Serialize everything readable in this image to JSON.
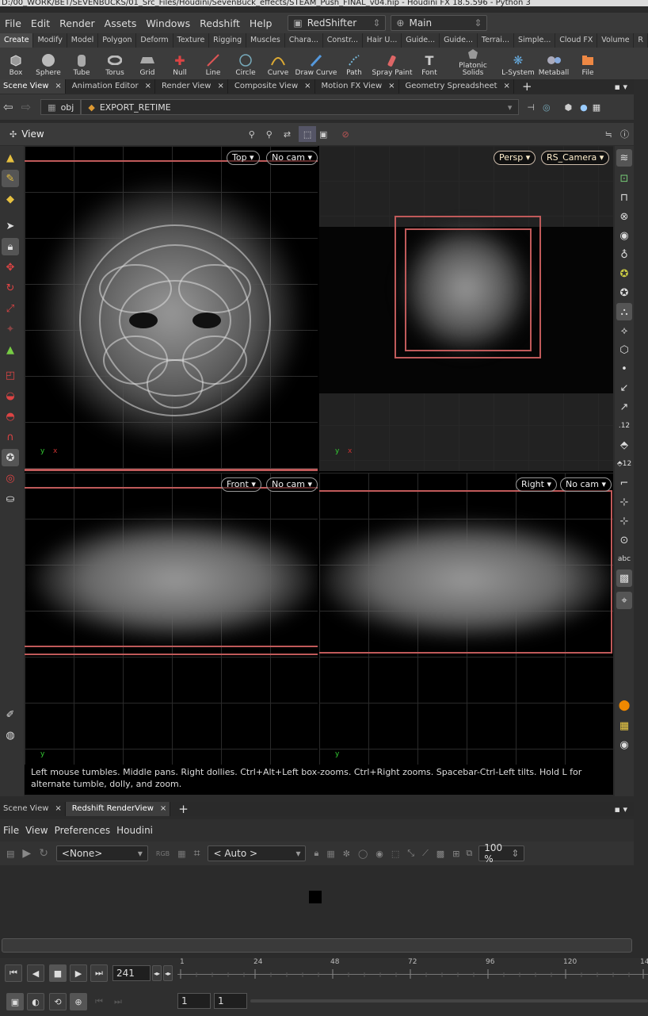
{
  "window": {
    "title": "D:/00_WORK/BET/SEVENBUCKS/01_Src_Files/Houdini/SevenBuck_effects/STEAM_Push_FINAL_v04.hip - Houdini FX 18.5.596 - Python 3"
  },
  "menu": {
    "items": [
      "File",
      "Edit",
      "Render",
      "Assets",
      "Windows",
      "Redshift",
      "Help"
    ],
    "desktop": "RedShifter",
    "context": "Main"
  },
  "shelf_tabs": [
    "Create",
    "Modify",
    "Model",
    "Polygon",
    "Deform",
    "Texture",
    "Rigging",
    "Muscles",
    "Chara...",
    "Constr...",
    "Hair U...",
    "Guide...",
    "Guide...",
    "Terrai...",
    "Simple...",
    "Cloud FX",
    "Volume",
    "R"
  ],
  "shelf_tools": [
    {
      "label": "Box",
      "icon": "box-icon"
    },
    {
      "label": "Sphere",
      "icon": "sphere-icon"
    },
    {
      "label": "Tube",
      "icon": "tube-icon"
    },
    {
      "label": "Torus",
      "icon": "torus-icon"
    },
    {
      "label": "Grid",
      "icon": "grid-icon"
    },
    {
      "label": "Null",
      "icon": "null-icon"
    },
    {
      "label": "Line",
      "icon": "line-icon"
    },
    {
      "label": "Circle",
      "icon": "circle-icon"
    },
    {
      "label": "Curve",
      "icon": "curve-icon"
    },
    {
      "label": "Draw Curve",
      "icon": "draw-curve-icon"
    },
    {
      "label": "Path",
      "icon": "path-icon"
    },
    {
      "label": "Spray Paint",
      "icon": "spray-paint-icon"
    },
    {
      "label": "Font",
      "icon": "font-icon"
    },
    {
      "label": "Platonic Solids",
      "icon": "platonic-icon"
    },
    {
      "label": "L-System",
      "icon": "lsystem-icon"
    },
    {
      "label": "Metaball",
      "icon": "metaball-icon"
    },
    {
      "label": "File",
      "icon": "file-icon"
    }
  ],
  "pane_tabs": [
    "Scene View",
    "Animation Editor",
    "Render View",
    "Composite View",
    "Motion FX View",
    "Geometry Spreadsheet"
  ],
  "path": {
    "root": "obj",
    "node": "EXPORT_RETIME"
  },
  "view": {
    "label": "View"
  },
  "viewports": {
    "top_left": {
      "view": "Top",
      "cam": "No cam"
    },
    "top_right": {
      "view": "Persp",
      "cam": "RS_Camera"
    },
    "bottom_left": {
      "view": "Front",
      "cam": "No cam"
    },
    "bottom_right": {
      "view": "Right",
      "cam": "No cam"
    }
  },
  "hint": "Left mouse tumbles. Middle pans. Right dollies. Ctrl+Alt+Left box-zooms. Ctrl+Right zooms. Spacebar-Ctrl-Left tilts. Hold L for alternate tumble, dolly, and zoom.",
  "bottom_tabs": [
    "Scene View",
    "Redshift RenderView"
  ],
  "rv_menu": [
    "File",
    "View",
    "Preferences",
    "Houdini"
  ],
  "rv_toolbar": {
    "aov": "<None>",
    "camera": "< Auto >",
    "zoom": "100 %"
  },
  "timeline": {
    "frame": "241",
    "ticks": [
      "1",
      "24",
      "48",
      "72",
      "96",
      "120",
      "14"
    ],
    "start": "1",
    "end": "1"
  },
  "colors": {
    "accent": "#d0a020",
    "bbox": "#c05a5a"
  }
}
